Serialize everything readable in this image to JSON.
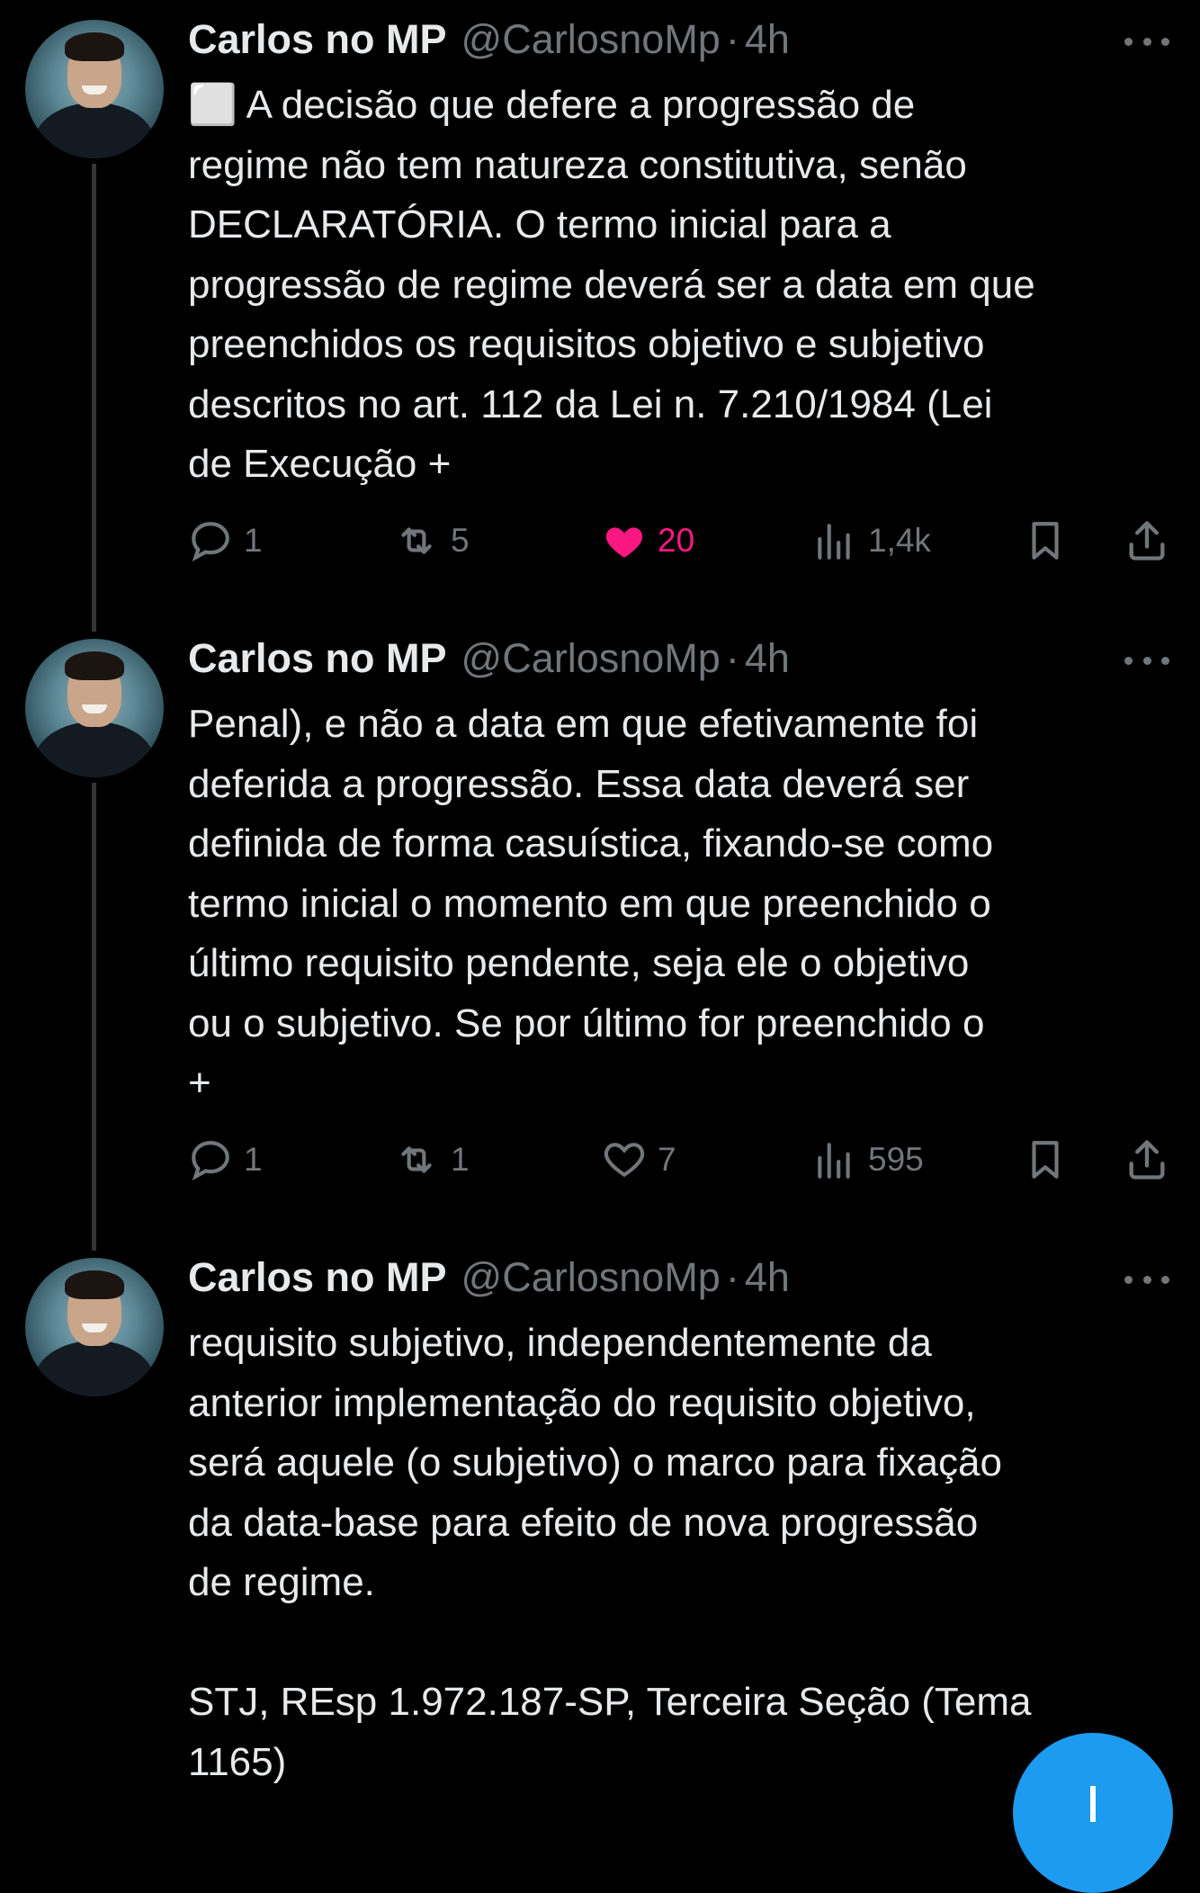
{
  "tweets": [
    {
      "name": "Carlos no MP",
      "handle": "@CarlosnoMp",
      "time": "4h",
      "text": "⬜ A decisão que defere a progressão de\nregime não tem natureza constitutiva, senão\nDECLARATÓRIA. O termo inicial para a\nprogressão de regime deverá ser a data em que\npreenchidos os requisitos objetivo e subjetivo\ndescritos no art. 112 da Lei n. 7.210/1984 (Lei\nde Execução +",
      "replies": "1",
      "reposts": "5",
      "likes": "20",
      "liked": true,
      "views": "1,4k"
    },
    {
      "name": "Carlos no MP",
      "handle": "@CarlosnoMp",
      "time": "4h",
      "text": "Penal), e não a data em que efetivamente foi\ndeferida a progressão. Essa data deverá ser\ndefinida de forma casuística, fixando-se como\ntermo inicial o momento em que preenchido o\núltimo requisito pendente, seja ele o objetivo\nou o subjetivo. Se por último for preenchido o\n+",
      "replies": "1",
      "reposts": "1",
      "likes": "7",
      "liked": false,
      "views": "595"
    },
    {
      "name": "Carlos no MP",
      "handle": "@CarlosnoMp",
      "time": "4h",
      "text": "requisito subjetivo, independentemente da\nanterior implementação do requisito objetivo,\nserá aquele (o subjetivo) o marco para fixação\nda data-base para efeito de nova progressão\nde regime.\n\nSTJ, REsp 1.972.187-SP, Terceira Seção (Tema\n1165)"
    }
  ],
  "separator": "·",
  "colors": {
    "like_active": "#f91880",
    "muted": "#71767b",
    "fab": "#1d9bf0",
    "thread_line": "#333639"
  },
  "icons": [
    "reply-icon",
    "repost-icon",
    "like-icon",
    "views-icon",
    "bookmark-icon",
    "share-icon",
    "more-icon",
    "compose-icon"
  ]
}
